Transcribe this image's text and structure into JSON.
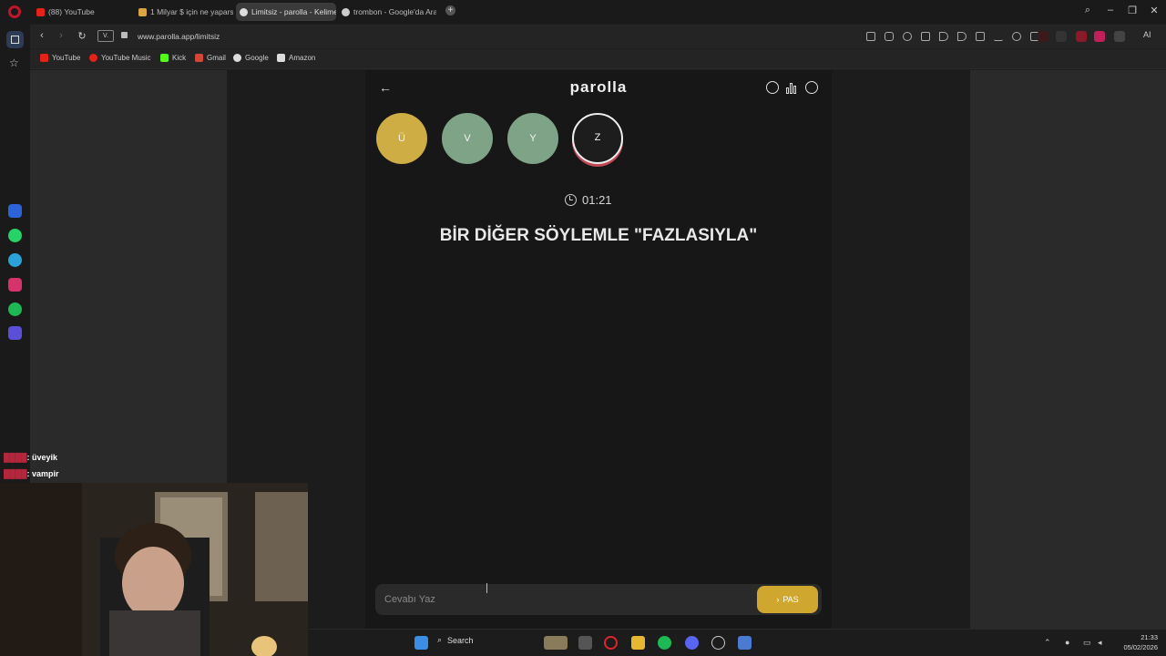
{
  "browser": {
    "tabs": [
      {
        "label": "(88) YouTube",
        "color": "#e62117",
        "active": false
      },
      {
        "label": "1 Milyar $ için ne yaparsın",
        "color": "#d9a441",
        "active": false
      },
      {
        "label": "Limitsiz - parolla - Kelime",
        "color": "#dddddd",
        "active": true
      },
      {
        "label": "trombon - Google'da Ara",
        "color": "#cccccc",
        "active": false
      }
    ],
    "address": {
      "badge": "V.",
      "url": "www.parolla.app/limitsiz"
    },
    "ai_label": "AI",
    "bookmarks": [
      "YouTube",
      "YouTube Music",
      "Kick",
      "Gmail",
      "Google",
      "Amazon"
    ]
  },
  "game": {
    "logo": "parolla",
    "letters": [
      {
        "letter": "Ü",
        "state": "passed",
        "color": "#cfad45"
      },
      {
        "letter": "V",
        "state": "correct",
        "color": "#7fa387"
      },
      {
        "letter": "Y",
        "state": "correct",
        "color": "#7fa387"
      },
      {
        "letter": "Z",
        "state": "current",
        "color": "#1d1d1d"
      }
    ],
    "timer": "01:21",
    "question": "BİR DİĞER SÖYLEMLE \"FAZLASIYLA\"",
    "answer_placeholder": "Cevabı Yaz",
    "pass_label": "PAS"
  },
  "stream_chat": [
    {
      "user": "████",
      "message": ": üveyik"
    },
    {
      "user": "████",
      "message": ": vampir"
    }
  ],
  "taskbar": {
    "search_label": "Search",
    "time": "21:33",
    "date": "05/02/2026"
  }
}
